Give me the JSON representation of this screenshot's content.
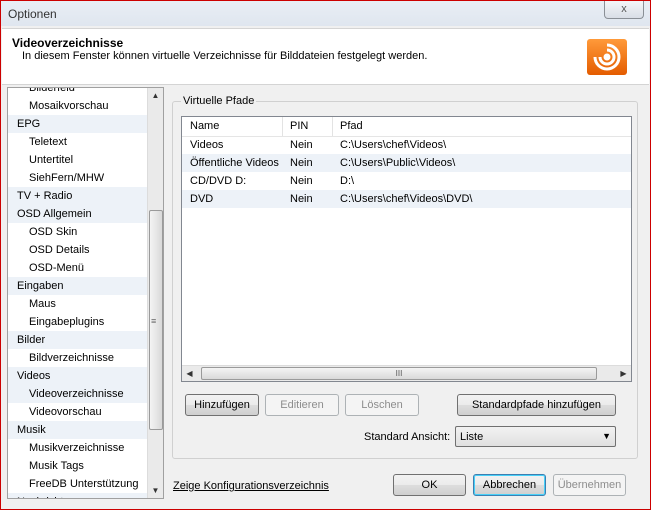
{
  "window": {
    "title": "Optionen",
    "close_label": "x"
  },
  "header": {
    "title": "Videoverzeichnisse",
    "description": "In diesem Fenster können virtuelle Verzeichnisse für Bilddateien festgelegt werden."
  },
  "nav": {
    "items": [
      {
        "label": "Bilderfeld",
        "type": "sub"
      },
      {
        "label": "Mosaikvorschau",
        "type": "sub"
      },
      {
        "label": "EPG",
        "type": "cat"
      },
      {
        "label": "Teletext",
        "type": "sub"
      },
      {
        "label": "Untertitel",
        "type": "sub"
      },
      {
        "label": "SiehFern/MHW",
        "type": "sub"
      },
      {
        "label": "TV + Radio",
        "type": "cat"
      },
      {
        "label": "OSD Allgemein",
        "type": "cat"
      },
      {
        "label": "OSD Skin",
        "type": "sub"
      },
      {
        "label": "OSD Details",
        "type": "sub"
      },
      {
        "label": "OSD-Menü",
        "type": "sub"
      },
      {
        "label": "Eingaben",
        "type": "cat"
      },
      {
        "label": "Maus",
        "type": "sub"
      },
      {
        "label": "Eingabeplugins",
        "type": "sub"
      },
      {
        "label": "Bilder",
        "type": "cat"
      },
      {
        "label": "Bildverzeichnisse",
        "type": "sub"
      },
      {
        "label": "Videos",
        "type": "cat"
      },
      {
        "label": "Videoverzeichnisse",
        "type": "sub",
        "selected": true
      },
      {
        "label": "Videovorschau",
        "type": "sub"
      },
      {
        "label": "Musik",
        "type": "cat"
      },
      {
        "label": "Musikverzeichnisse",
        "type": "sub"
      },
      {
        "label": "Musik Tags",
        "type": "sub"
      },
      {
        "label": "FreeDB Unterstützung",
        "type": "sub"
      },
      {
        "label": "Nachrichten",
        "type": "cat"
      }
    ]
  },
  "paths": {
    "group_label": "Virtuelle Pfade",
    "columns": [
      "Name",
      "PIN",
      "Pfad"
    ],
    "rows": [
      [
        "Videos",
        "Nein",
        "C:\\Users\\chef\\Videos\\"
      ],
      [
        "Öffentliche Videos",
        "Nein",
        "C:\\Users\\Public\\Videos\\"
      ],
      [
        "CD/DVD D:",
        "Nein",
        "D:\\"
      ],
      [
        "DVD",
        "Nein",
        "C:\\Users\\chef\\Videos\\DVD\\"
      ]
    ],
    "scroll_grip": "III"
  },
  "buttons": {
    "add": "Hinzufügen",
    "edit": "Editieren",
    "delete": "Löschen",
    "add_defaults": "Standardpfade hinzufügen",
    "ok": "OK",
    "cancel": "Abbrechen",
    "apply": "Übernehmen"
  },
  "view": {
    "label": "Standard Ansicht:",
    "value": "Liste"
  },
  "footer": {
    "link": "Zeige Konfigurationsverzeichnis"
  }
}
